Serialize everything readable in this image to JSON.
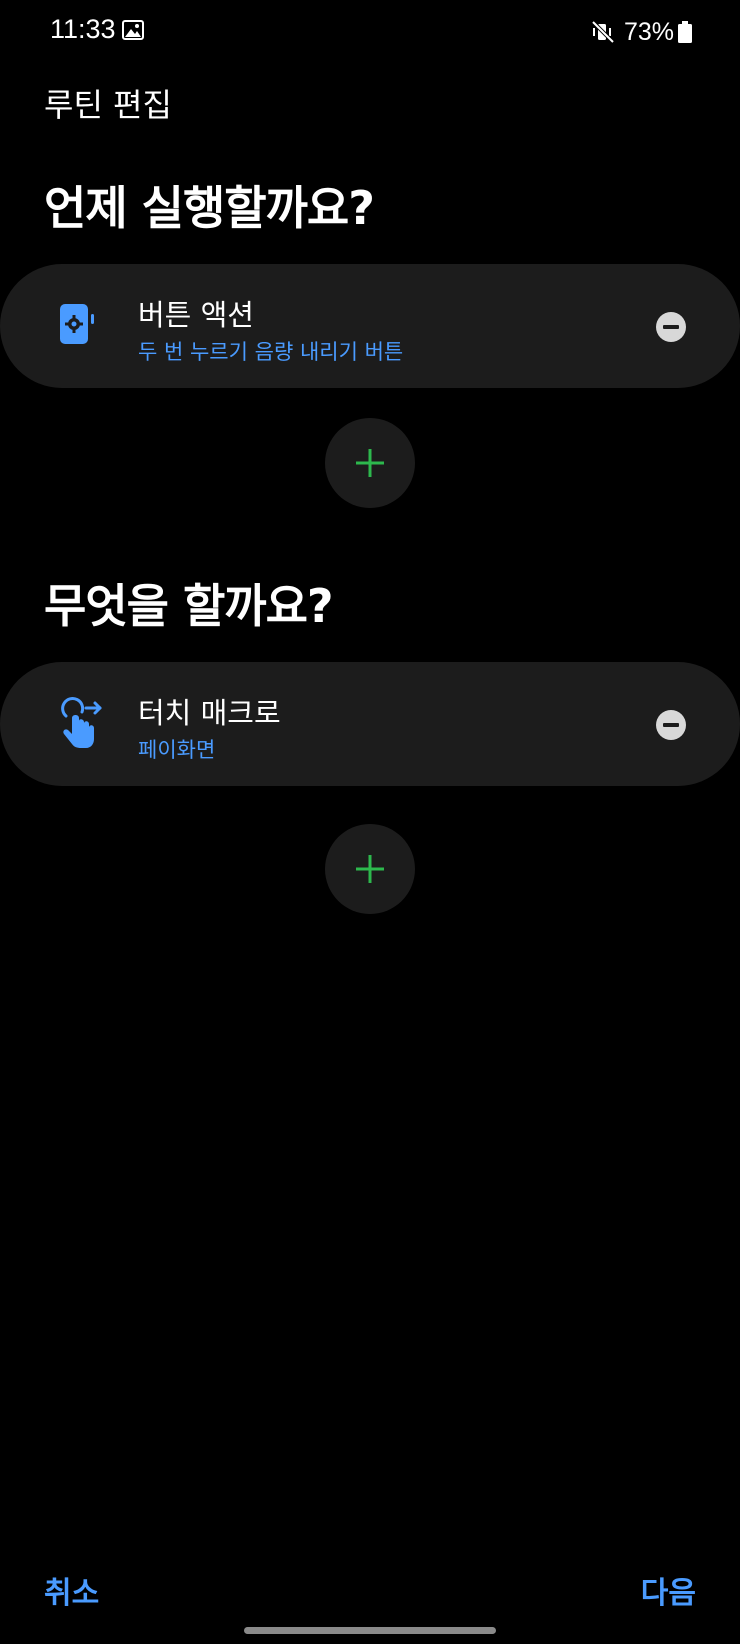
{
  "status_bar": {
    "time": "11:33",
    "battery_text": "73%",
    "icons": [
      "gallery-icon",
      "mute-vibrate-icon",
      "battery-icon"
    ]
  },
  "header": {
    "title": "루틴 편집"
  },
  "when_section": {
    "heading": "언제 실행할까요?",
    "condition": {
      "title": "버튼 액션",
      "subtitle": "두 번 누르기 음량 내리기 버튼",
      "icon": "button-action-icon"
    },
    "add_icon": "plus-icon"
  },
  "what_section": {
    "heading": "무엇을 할까요?",
    "action": {
      "title": "터치 매크로",
      "subtitle": "페이화면",
      "icon": "touch-macro-icon"
    },
    "add_icon": "plus-icon"
  },
  "footer": {
    "cancel_label": "취소",
    "next_label": "다음"
  },
  "colors": {
    "background": "#000000",
    "card": "#1c1c1c",
    "accent_blue": "#4a9bff",
    "add_green": "#2db84d"
  }
}
